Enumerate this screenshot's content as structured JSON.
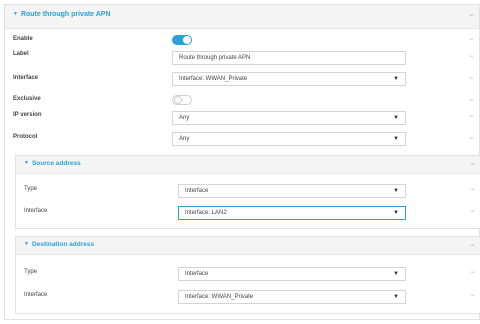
{
  "panel": {
    "title": "Route through private APN",
    "more": "···"
  },
  "fields": {
    "enable": {
      "label": "Enable",
      "value": "on"
    },
    "label": {
      "label": "Label",
      "value": "Route through private APN"
    },
    "interface": {
      "label": "Interface",
      "value": "Interface: WWAN_Private"
    },
    "exclusive": {
      "label": "Exclusive",
      "value": "off"
    },
    "ip_version": {
      "label": "IP version",
      "value": "Any"
    },
    "protocol": {
      "label": "Protocol",
      "value": "Any"
    }
  },
  "source": {
    "title": "Source address",
    "type": {
      "label": "Type",
      "value": "Interface"
    },
    "interface": {
      "label": "Interface",
      "value": "Interface: LAN2"
    }
  },
  "destination": {
    "title": "Destination address",
    "type": {
      "label": "Type",
      "value": "Interface"
    },
    "interface": {
      "label": "Interface",
      "value": "Interface: WWAN_Private"
    }
  },
  "icons": {
    "collapse": "triangle-down-icon",
    "dropdown": "chevron-down-icon",
    "more": "more-icon"
  },
  "colors": {
    "accent": "#2aa0d8"
  }
}
